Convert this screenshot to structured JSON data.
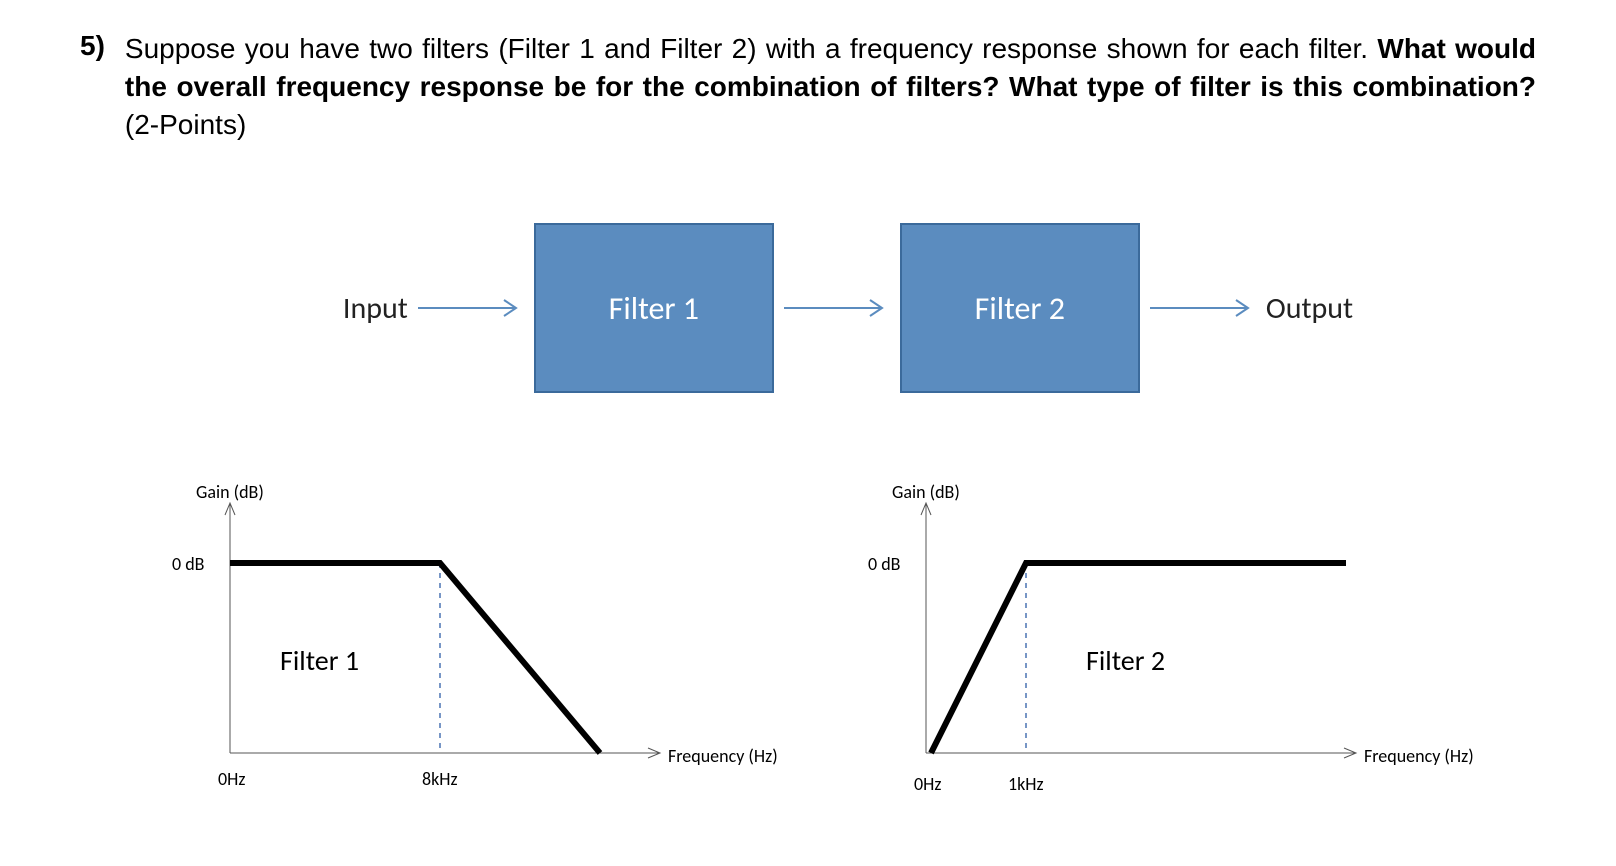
{
  "question": {
    "number": "5)",
    "text_part1": "Suppose you have two filters (Filter 1 and Filter 2) with a frequency response shown for each filter. ",
    "text_bold": "What would the overall frequency response be for the combination of filters? What type of filter is this combination?",
    "text_points": " (2-Points)"
  },
  "block_diagram": {
    "input": "Input",
    "filter1": "Filter 1",
    "filter2": "Filter 2",
    "output": "Output"
  },
  "plots": {
    "filter1": {
      "title": "Filter 1",
      "ylabel": "Gain (dB)",
      "xlabel": "Frequency (Hz)",
      "y0": "0 dB",
      "x0": "0Hz",
      "cutoff": "8kHz"
    },
    "filter2": {
      "title": "Filter 2",
      "ylabel": "Gain (dB)",
      "xlabel": "Frequency (Hz)",
      "y0": "0 dB",
      "x0": "0Hz",
      "cutoff": "1kHz"
    }
  },
  "chart_data": [
    {
      "type": "line",
      "title": "Filter 1",
      "xlabel": "Frequency (Hz)",
      "ylabel": "Gain (dB)",
      "description": "Low-pass filter frequency response",
      "passband_gain_db": 0,
      "cutoff_frequency_hz": 8000,
      "shape": "flat at 0 dB from 0 Hz to 8 kHz, then rolls off with negative slope"
    },
    {
      "type": "line",
      "title": "Filter 2",
      "xlabel": "Frequency (Hz)",
      "ylabel": "Gain (dB)",
      "description": "High-pass filter frequency response",
      "passband_gain_db": 0,
      "cutoff_frequency_hz": 1000,
      "shape": "rises from low gain at 0 Hz up to 0 dB at 1 kHz, then flat at 0 dB"
    }
  ]
}
